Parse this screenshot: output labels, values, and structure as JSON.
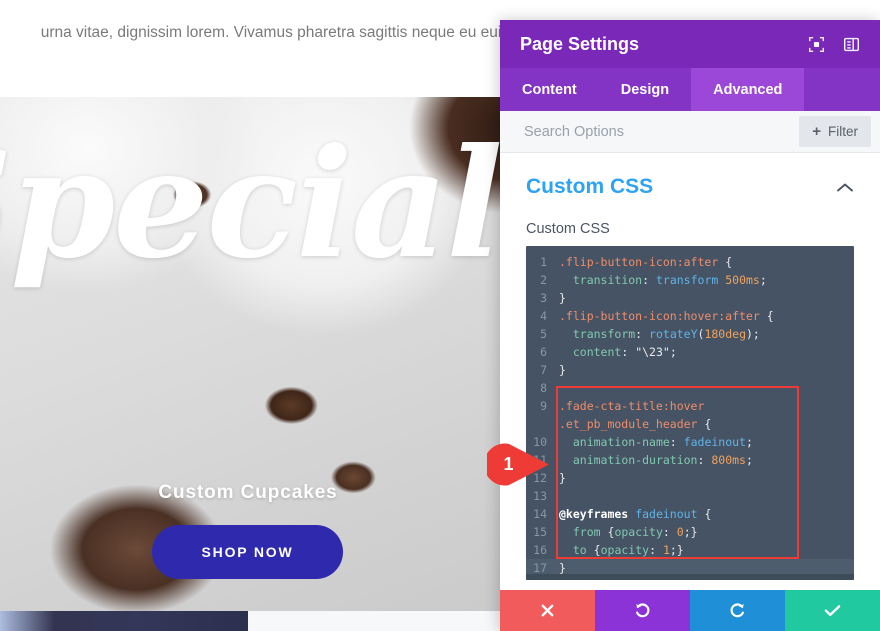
{
  "site": {
    "paragraph_lines": [
      "urna vitae, dignissim lorem. Vivamus pharetra sagittis neque eu euismod"
    ],
    "hero": {
      "title": "Special Offer",
      "subtitle": "Custom Cupcakes",
      "button_label": "SHOP NOW",
      "button_color": "#2f29ae"
    }
  },
  "panel": {
    "title": "Page Settings",
    "header_icons": [
      {
        "name": "fullscreen-icon"
      },
      {
        "name": "layout-panel-icon"
      }
    ],
    "accent_color": "#7a28b8",
    "tabs": [
      {
        "label": "Content",
        "active": false
      },
      {
        "label": "Design",
        "active": false
      },
      {
        "label": "Advanced",
        "active": true
      }
    ],
    "search": {
      "placeholder": "Search Options",
      "value": ""
    },
    "filter_button": {
      "label": "Filter",
      "icon": "plus-icon"
    },
    "section": {
      "title": "Custom CSS",
      "collapse_icon": "chevron-up-icon",
      "field_label": "Custom CSS"
    },
    "callout": {
      "number": "1",
      "color": "#ee3b36"
    },
    "actions": [
      {
        "name": "cancel-button",
        "icon": "close-icon",
        "color": "#f25b5b"
      },
      {
        "name": "undo-button",
        "icon": "undo-icon",
        "color": "#8b33d6"
      },
      {
        "name": "redo-button",
        "icon": "redo-icon",
        "color": "#1f8fd8"
      },
      {
        "name": "save-button",
        "icon": "check-icon",
        "color": "#21c9a0"
      }
    ]
  },
  "code": {
    "language": "css",
    "lines": [
      {
        "num": "1",
        "tokens": [
          {
            "t": "sel",
            "v": ".flip-button-icon:after"
          },
          {
            "t": "plain",
            "v": " "
          },
          {
            "t": "pun",
            "v": "{"
          }
        ]
      },
      {
        "num": "2",
        "tokens": [
          {
            "t": "plain",
            "v": "  "
          },
          {
            "t": "prop",
            "v": "transition"
          },
          {
            "t": "pun",
            "v": ":"
          },
          {
            "t": "plain",
            "v": " "
          },
          {
            "t": "val",
            "v": "transform"
          },
          {
            "t": "plain",
            "v": " "
          },
          {
            "t": "num",
            "v": "500ms"
          },
          {
            "t": "pun",
            "v": ";"
          }
        ]
      },
      {
        "num": "3",
        "tokens": [
          {
            "t": "pun",
            "v": "}"
          }
        ]
      },
      {
        "num": "4",
        "tokens": [
          {
            "t": "sel",
            "v": ".flip-button-icon:hover:after"
          },
          {
            "t": "plain",
            "v": " "
          },
          {
            "t": "pun",
            "v": "{"
          }
        ]
      },
      {
        "num": "5",
        "tokens": [
          {
            "t": "plain",
            "v": "  "
          },
          {
            "t": "prop",
            "v": "transform"
          },
          {
            "t": "pun",
            "v": ":"
          },
          {
            "t": "plain",
            "v": " "
          },
          {
            "t": "val",
            "v": "rotateY"
          },
          {
            "t": "pun",
            "v": "("
          },
          {
            "t": "num",
            "v": "180deg"
          },
          {
            "t": "pun",
            "v": ");"
          }
        ]
      },
      {
        "num": "6",
        "tokens": [
          {
            "t": "plain",
            "v": "  "
          },
          {
            "t": "prop",
            "v": "content"
          },
          {
            "t": "pun",
            "v": ":"
          },
          {
            "t": "plain",
            "v": " "
          },
          {
            "t": "str",
            "v": "\"\\23\""
          },
          {
            "t": "pun",
            "v": ";"
          }
        ]
      },
      {
        "num": "7",
        "tokens": [
          {
            "t": "pun",
            "v": "}"
          }
        ]
      },
      {
        "num": "8",
        "tokens": [
          {
            "t": "plain",
            "v": ""
          }
        ]
      },
      {
        "num": "9",
        "tokens": [
          {
            "t": "sel",
            "v": ".fade-cta-title:hover"
          }
        ]
      },
      {
        "num": "",
        "tokens": [
          {
            "t": "sel",
            "v": ".et_pb_module_header"
          },
          {
            "t": "plain",
            "v": " "
          },
          {
            "t": "pun",
            "v": "{"
          }
        ]
      },
      {
        "num": "10",
        "tokens": [
          {
            "t": "plain",
            "v": "  "
          },
          {
            "t": "prop",
            "v": "animation-name"
          },
          {
            "t": "pun",
            "v": ":"
          },
          {
            "t": "plain",
            "v": " "
          },
          {
            "t": "val",
            "v": "fadeinout"
          },
          {
            "t": "pun",
            "v": ";"
          }
        ]
      },
      {
        "num": "11",
        "tokens": [
          {
            "t": "plain",
            "v": "  "
          },
          {
            "t": "prop",
            "v": "animation-duration"
          },
          {
            "t": "pun",
            "v": ":"
          },
          {
            "t": "plain",
            "v": " "
          },
          {
            "t": "num",
            "v": "800ms"
          },
          {
            "t": "pun",
            "v": ";"
          }
        ]
      },
      {
        "num": "12",
        "tokens": [
          {
            "t": "pun",
            "v": "}"
          }
        ]
      },
      {
        "num": "13",
        "tokens": [
          {
            "t": "plain",
            "v": ""
          }
        ]
      },
      {
        "num": "14",
        "tokens": [
          {
            "t": "at",
            "v": "@keyframes"
          },
          {
            "t": "plain",
            "v": " "
          },
          {
            "t": "val",
            "v": "fadeinout"
          },
          {
            "t": "plain",
            "v": " "
          },
          {
            "t": "pun",
            "v": "{"
          }
        ]
      },
      {
        "num": "15",
        "tokens": [
          {
            "t": "plain",
            "v": "  "
          },
          {
            "t": "kw",
            "v": "from"
          },
          {
            "t": "plain",
            "v": " "
          },
          {
            "t": "pun",
            "v": "{"
          },
          {
            "t": "prop",
            "v": "opacity"
          },
          {
            "t": "pun",
            "v": ":"
          },
          {
            "t": "plain",
            "v": " "
          },
          {
            "t": "num",
            "v": "0"
          },
          {
            "t": "pun",
            "v": ";}"
          }
        ]
      },
      {
        "num": "16",
        "tokens": [
          {
            "t": "plain",
            "v": "  "
          },
          {
            "t": "kw",
            "v": "to"
          },
          {
            "t": "plain",
            "v": " "
          },
          {
            "t": "pun",
            "v": "{"
          },
          {
            "t": "prop",
            "v": "opacity"
          },
          {
            "t": "pun",
            "v": ":"
          },
          {
            "t": "plain",
            "v": " "
          },
          {
            "t": "num",
            "v": "1"
          },
          {
            "t": "pun",
            "v": ";}"
          }
        ]
      },
      {
        "num": "17",
        "tokens": [
          {
            "t": "pun",
            "v": "}"
          }
        ],
        "highlight": true
      }
    ]
  }
}
